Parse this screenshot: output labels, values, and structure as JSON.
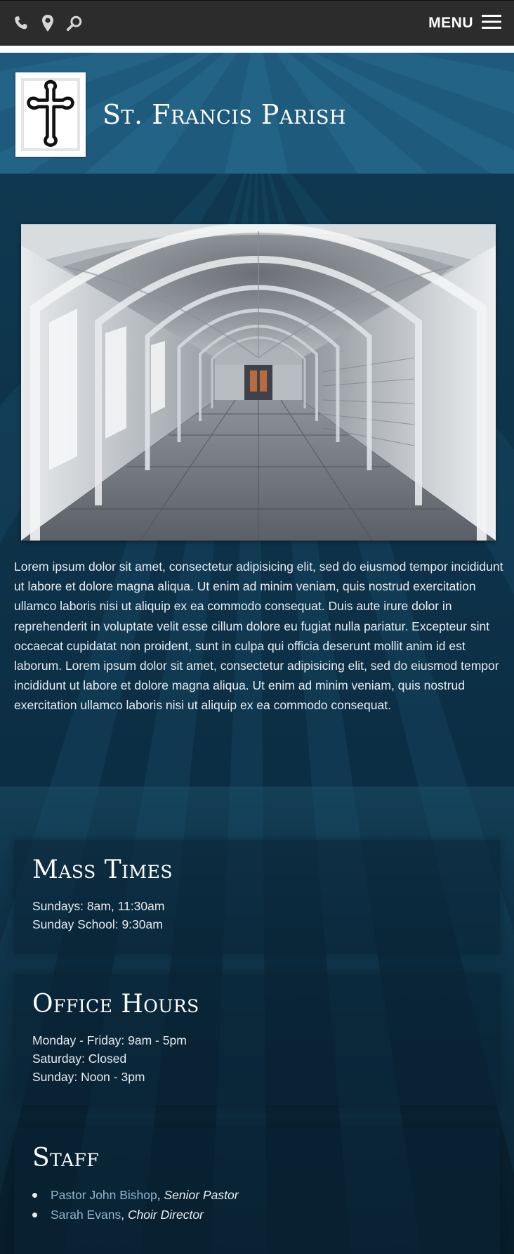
{
  "topbar": {
    "icons": [
      "phone-icon",
      "location-pin-icon",
      "search-icon"
    ],
    "menu_label": "MENU",
    "menu_icon": "hamburger-icon"
  },
  "header": {
    "title": "St. Francis Parish",
    "logo": "cross-icon"
  },
  "hero_image": "cloister-archway-corridor",
  "intro": "Lorem ipsum dolor sit amet, consectetur adipisicing elit, sed do eiusmod tempor incididunt ut labore et dolore magna aliqua. Ut enim ad minim veniam, quis nostrud exercitation ullamco laboris nisi ut aliquip ex ea commodo consequat. Duis aute irure dolor in reprehenderit in voluptate velit esse cillum dolore eu fugiat nulla pariatur. Excepteur sint occaecat cupidatat non proident, sunt in culpa qui officia deserunt mollit anim id est laborum. Lorem ipsum dolor sit amet, consectetur adipisicing elit, sed do eiusmod tempor incididunt ut labore et dolore magna aliqua. Ut enim ad minim veniam, quis nostrud exercitation ullamco laboris nisi ut aliquip ex ea commodo consequat.",
  "mass_times": {
    "title": "Mass Times",
    "lines": [
      "Sundays: 8am, 11:30am",
      "Sunday School: 9:30am"
    ]
  },
  "office_hours": {
    "title": "Office Hours",
    "lines": [
      "Monday - Friday: 9am - 5pm",
      "Saturday: Closed",
      "Sunday: Noon - 3pm"
    ]
  },
  "staff": {
    "title": "Staff",
    "members": [
      {
        "name": "Pastor John Bishop",
        "role": "Senior Pastor"
      },
      {
        "name": "Sarah Evans",
        "role": "Choir Director"
      }
    ]
  },
  "colors": {
    "topbar": "#2c2c2c",
    "header": "#1e5a7c",
    "body": "#0c2e44",
    "link": "#8fb4cc"
  }
}
